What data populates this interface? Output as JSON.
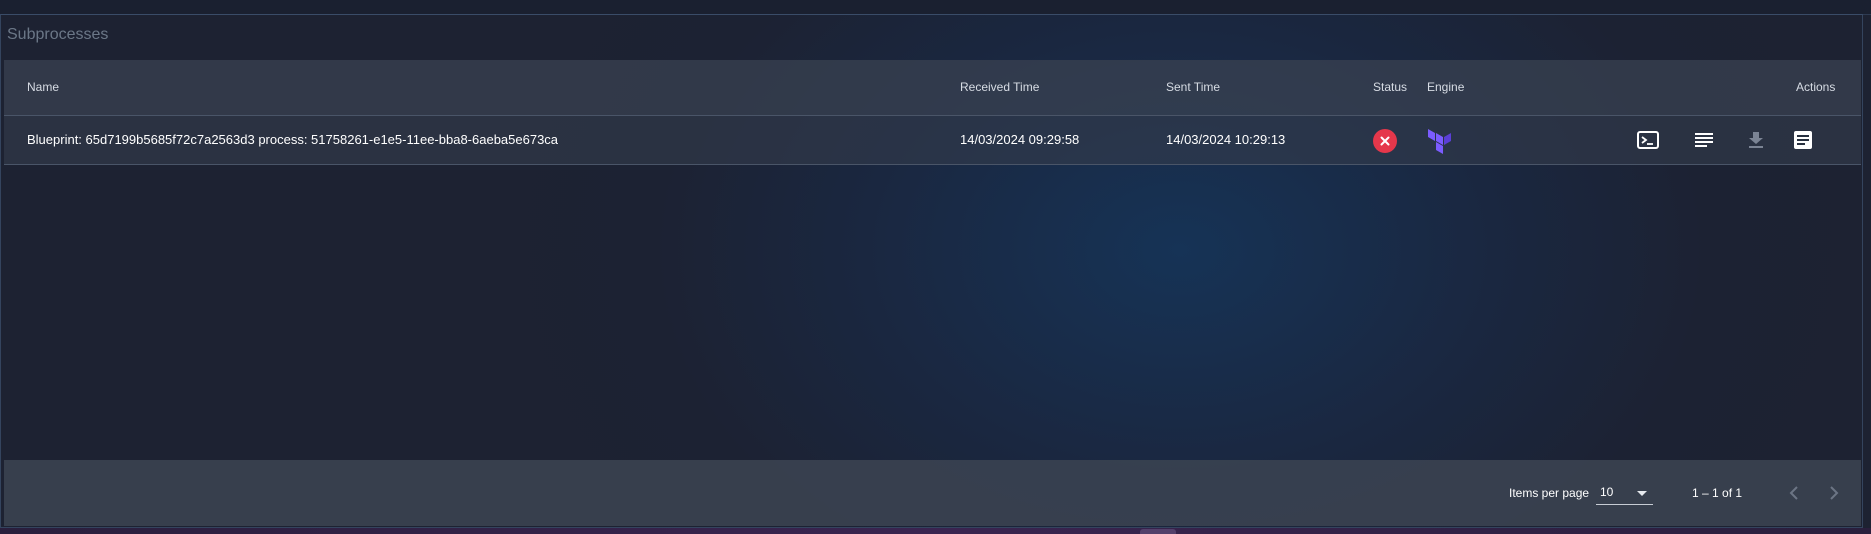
{
  "panel": {
    "title": "Subprocesses"
  },
  "table": {
    "columns": {
      "name": "Name",
      "received_time": "Received Time",
      "sent_time": "Sent Time",
      "status": "Status",
      "engine": "Engine",
      "actions": "Actions"
    },
    "rows": [
      {
        "name": "Blueprint: 65d7199b5685f72c7a2563d3 process: 51758261-e1e5-11ee-bba8-6aeba5e673ca",
        "received_time": "14/03/2024 09:29:58",
        "sent_time": "14/03/2024 10:29:13",
        "status_icon": "error-circle-icon",
        "engine_icon": "terraform-icon",
        "action_icons": [
          "terminal-icon",
          "notes-icon",
          "download-icon",
          "document-icon"
        ]
      }
    ]
  },
  "paginator": {
    "items_per_page_label": "Items per page",
    "items_per_page_value": "10",
    "range_label": "1 – 1 of 1",
    "prev_icon": "chevron-left-icon",
    "next_icon": "chevron-right-icon"
  },
  "colors": {
    "status_error": "#e5374b",
    "engine_terraform": "#6e4ee0",
    "action_enabled": "#ffffff",
    "action_disabled": "#7b8494"
  }
}
